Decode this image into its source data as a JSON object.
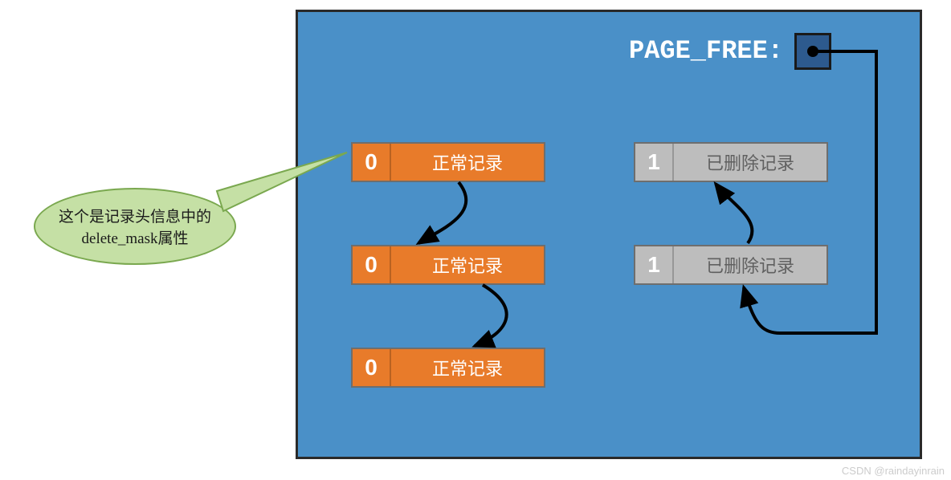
{
  "header": {
    "label": "PAGE_FREE:"
  },
  "records": {
    "normal": [
      {
        "mask": "0",
        "label": "正常记录"
      },
      {
        "mask": "0",
        "label": "正常记录"
      },
      {
        "mask": "0",
        "label": "正常记录"
      }
    ],
    "deleted": [
      {
        "mask": "1",
        "label": "已删除记录"
      },
      {
        "mask": "1",
        "label": "已删除记录"
      }
    ]
  },
  "callout": {
    "line1": "这个是记录头信息中的",
    "line2": "delete_mask属性"
  },
  "watermark": "CSDN @raindayinrain",
  "colors": {
    "container_bg": "#4a90c8",
    "normal_record": "#e87b2a",
    "deleted_record": "#bdbdbd",
    "callout_bg": "#c5e0a5"
  }
}
